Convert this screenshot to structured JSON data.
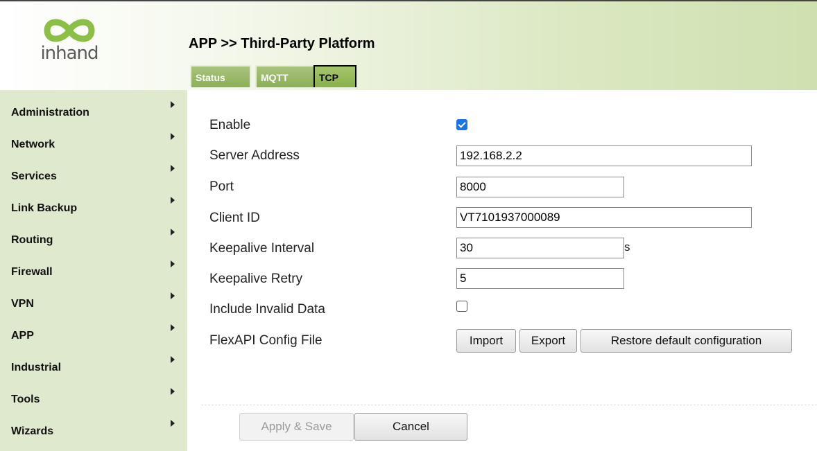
{
  "brand": {
    "logo_text": "inhand"
  },
  "header": {
    "title": "APP >> Third-Party Platform",
    "tabs": [
      {
        "label": "Status"
      },
      {
        "label": "MQTT"
      },
      {
        "label": "TCP"
      }
    ],
    "active_tab": "TCP"
  },
  "sidebar": {
    "items": [
      {
        "label": "Administration"
      },
      {
        "label": "Network"
      },
      {
        "label": "Services"
      },
      {
        "label": "Link Backup"
      },
      {
        "label": "Routing"
      },
      {
        "label": "Firewall"
      },
      {
        "label": "VPN"
      },
      {
        "label": "APP"
      },
      {
        "label": "Industrial"
      },
      {
        "label": "Tools"
      },
      {
        "label": "Wizards"
      }
    ]
  },
  "form": {
    "enable": {
      "label": "Enable",
      "checked": true
    },
    "server_address": {
      "label": "Server Address",
      "value": "192.168.2.2"
    },
    "port": {
      "label": "Port",
      "value": "8000"
    },
    "client_id": {
      "label": "Client ID",
      "value": "VT7101937000089"
    },
    "keepalive_interval": {
      "label": "Keepalive Interval",
      "value": "30",
      "unit": "s"
    },
    "keepalive_retry": {
      "label": "Keepalive Retry",
      "value": "5"
    },
    "include_invalid_data": {
      "label": "Include Invalid Data",
      "checked": false
    },
    "flexapi_config_file": {
      "label": "FlexAPI Config File",
      "import_label": "Import",
      "export_label": "Export",
      "restore_label": "Restore default configuration"
    }
  },
  "footer": {
    "apply_label": "Apply & Save",
    "cancel_label": "Cancel"
  },
  "colors": {
    "sidebar_bg": "#dfe9ce",
    "tab_green": "#8caf58",
    "checkbox_blue": "#1a73e8"
  }
}
